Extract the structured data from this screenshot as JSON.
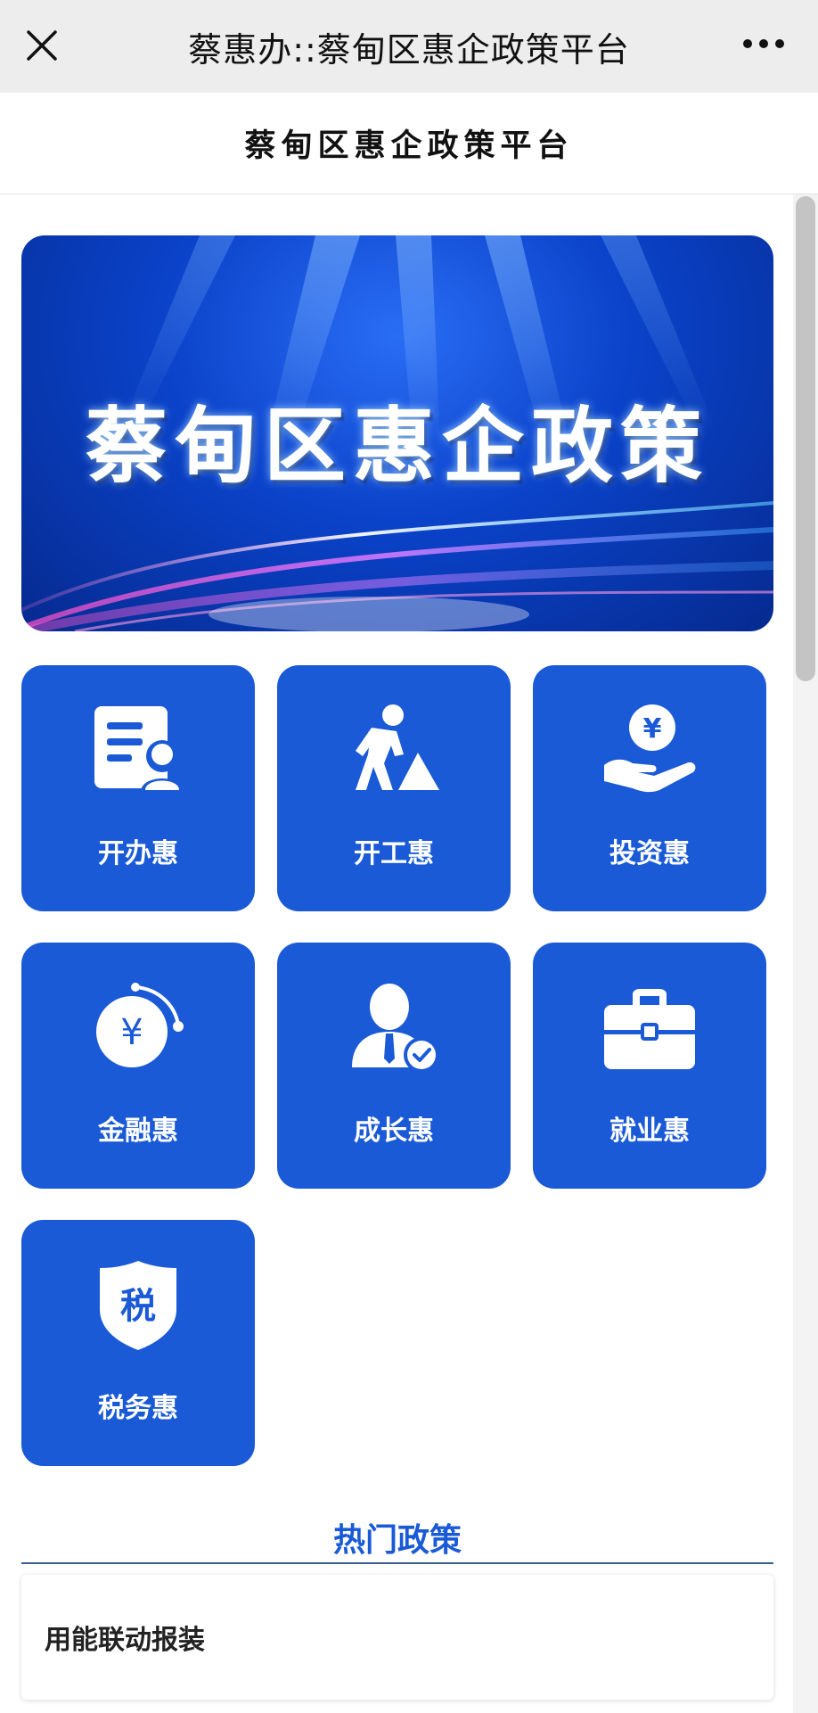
{
  "topbar": {
    "title": "蔡惠办::蔡甸区惠企政策平台",
    "close_icon": "close-icon",
    "more_icon": "more-dots-icon"
  },
  "header": {
    "title": "蔡甸区惠企政策平台"
  },
  "banner": {
    "title": "蔡甸区惠企政策"
  },
  "categories": [
    {
      "label": "开办惠",
      "icon": "document-person-icon"
    },
    {
      "label": "开工惠",
      "icon": "construction-worker-icon"
    },
    {
      "label": "投资惠",
      "icon": "hand-yuan-coin-icon"
    },
    {
      "label": "金融惠",
      "icon": "yuan-circle-icon"
    },
    {
      "label": "成长惠",
      "icon": "person-check-icon"
    },
    {
      "label": "就业惠",
      "icon": "briefcase-icon"
    },
    {
      "label": "税务惠",
      "icon": "tax-shield-icon",
      "icon_text": "税"
    }
  ],
  "hot_policy": {
    "title": "热门政策",
    "items": [
      {
        "name": "用能联动报装"
      }
    ]
  },
  "colors": {
    "tile": "#1a5ad7",
    "accent_text": "#1a5ad7",
    "topbar_bg": "#ededed"
  }
}
